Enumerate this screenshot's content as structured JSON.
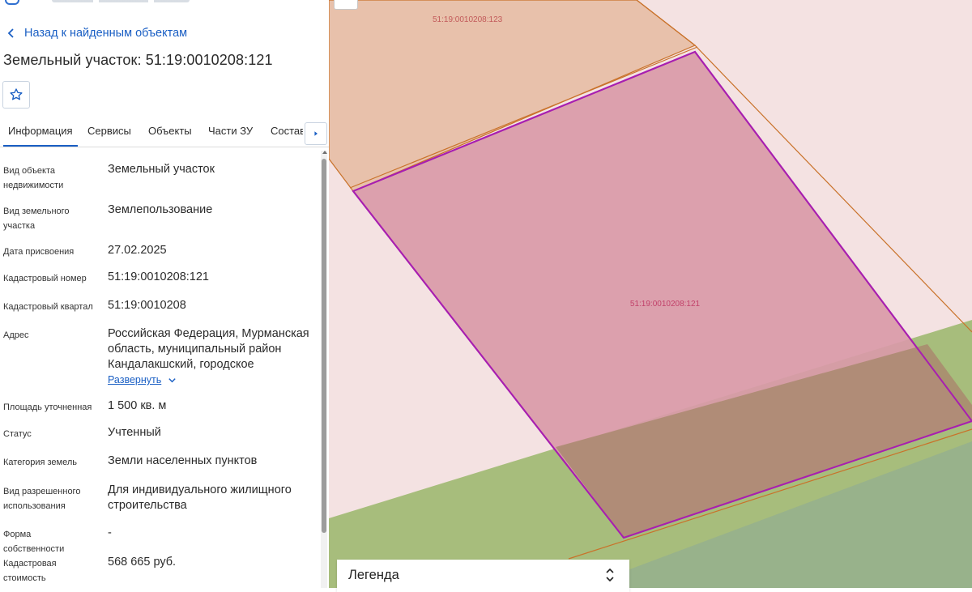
{
  "panel": {
    "back_label": "Назад к найденным объектам",
    "title": "Земельный участок: 51:19:0010208:121",
    "tabs": [
      "Информация",
      "Сервисы",
      "Объекты",
      "Части ЗУ",
      "Состав"
    ],
    "active_tab": "Информация",
    "rows": [
      {
        "label": "Вид объекта недвижимости",
        "value": "Земельный участок"
      },
      {
        "label": "Вид земельного участка",
        "value": "Землепользование"
      },
      {
        "label": "Дата присвоения",
        "value": "27.02.2025"
      },
      {
        "label": "Кадастровый номер",
        "value": "51:19:0010208:121"
      },
      {
        "label": "Кадастровый квартал",
        "value": "51:19:0010208"
      },
      {
        "label": "Адрес",
        "value": "Российская Федерация, Мурманская область, муниципальный район Кандалакшский, городское"
      },
      {
        "label": "Площадь уточненная",
        "value": "1 500 кв. м"
      },
      {
        "label": "Статус",
        "value": "Учтенный"
      },
      {
        "label": "Категория земель",
        "value": "Земли населенных пунктов"
      },
      {
        "label": "Вид разрешенного использования",
        "value": "Для индивидуального жилищного строительства"
      },
      {
        "label": "Форма собственности",
        "value": "-"
      },
      {
        "label": "Кадастровая стоимость",
        "value": "568 665 руб."
      }
    ],
    "expand_label": "Развернуть"
  },
  "map": {
    "parcel_label_main": "51:19:0010208:121",
    "parcel_label_neighbor": "51:19:0010208:123",
    "legend_label": "Легенда",
    "colors": {
      "background": "#f4e2e2",
      "neighbor_fill": "#e8c1ab",
      "neighbor_stroke": "#c9722a",
      "selected_fill": "#d99aa8",
      "selected_stroke": "#a81fb0",
      "green": "#a7bd7c",
      "green_dark": "#98b28b",
      "link": "#1a5fc4"
    }
  },
  "icons": {
    "back": "chevron-left-icon",
    "favorite": "star-outline-icon",
    "tab_scroll": "caret-right-icon",
    "expand": "chevron-down-icon",
    "legend_sort": "sort-updown-icon"
  }
}
